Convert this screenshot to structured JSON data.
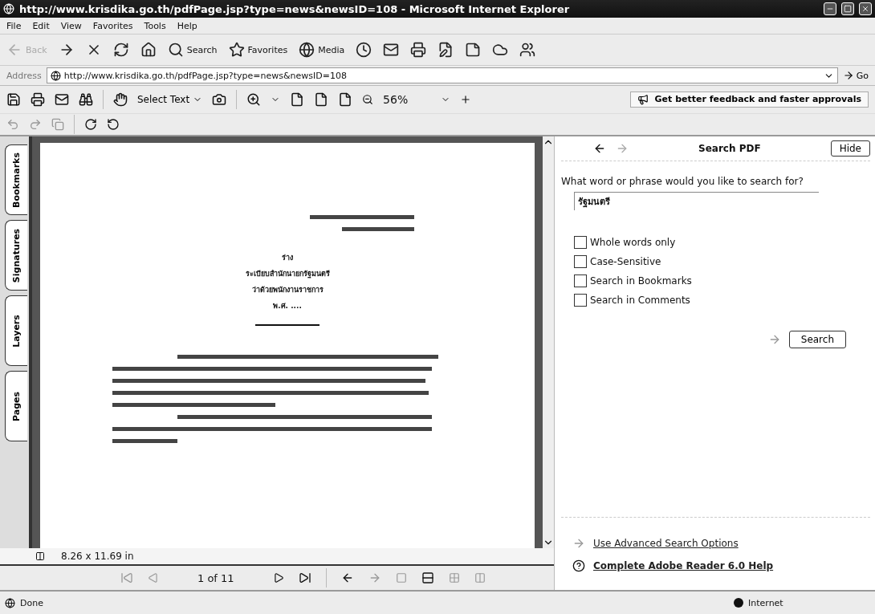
{
  "window": {
    "title": "http://www.krisdika.go.th/pdfPage.jsp?type=news&newsID=108 - Microsoft Internet Explorer"
  },
  "menu": [
    "File",
    "Edit",
    "View",
    "Favorites",
    "Tools",
    "Help"
  ],
  "toolbar": [
    {
      "kind": "back",
      "label": "Back",
      "disabled": true
    },
    {
      "kind": "forward",
      "disabled": false
    },
    {
      "kind": "stop",
      "disabled": false
    },
    {
      "kind": "refresh",
      "disabled": false
    },
    {
      "kind": "home",
      "disabled": false
    },
    {
      "kind": "search",
      "label": "Search",
      "disabled": false
    },
    {
      "kind": "favorites",
      "label": "Favorites",
      "disabled": false
    },
    {
      "kind": "media",
      "label": "Media",
      "disabled": false
    },
    {
      "kind": "history",
      "disabled": false
    },
    {
      "kind": "mail",
      "disabled": false
    },
    {
      "kind": "print",
      "disabled": false
    },
    {
      "kind": "edit",
      "disabled": false
    },
    {
      "kind": "note",
      "disabled": false
    },
    {
      "kind": "lite",
      "disabled": false
    },
    {
      "kind": "messenger",
      "disabled": false
    }
  ],
  "address": {
    "label": "Address",
    "value": "http://www.krisdika.go.th/pdfPage.jsp?type=news&newsID=108",
    "go": "Go"
  },
  "reader_toolbar": {
    "select_tool": "Select Text",
    "zoom": "56%",
    "promo": "Get better feedback and faster approvals"
  },
  "side_tabs": [
    "Bookmarks",
    "Signatures",
    "Layers",
    "Pages"
  ],
  "document": {
    "title_lines": [
      "ร่าง",
      "ระเบียบสำนักนายกรัฐมนตรี",
      "ว่าด้วยพนักงานราชการ",
      "พ.ศ. ...."
    ],
    "page_size": "8.26 x 11.69 in"
  },
  "nav": {
    "page": "1 of 11"
  },
  "search_pane": {
    "title": "Search PDF",
    "hide": "Hide",
    "prompt": "What word or phrase would you like to search for?",
    "query": "รัฐมนตรี",
    "options": [
      {
        "label": "Whole words only",
        "checked": false
      },
      {
        "label": "Case-Sensitive",
        "checked": false
      },
      {
        "label": "Search in Bookmarks",
        "checked": false
      },
      {
        "label": "Search in Comments",
        "checked": false
      }
    ],
    "search": "Search",
    "advanced": "Use Advanced Search Options",
    "help": "Complete Adobe Reader 6.0 Help"
  },
  "status": {
    "text": "Done",
    "zone": "Internet"
  }
}
